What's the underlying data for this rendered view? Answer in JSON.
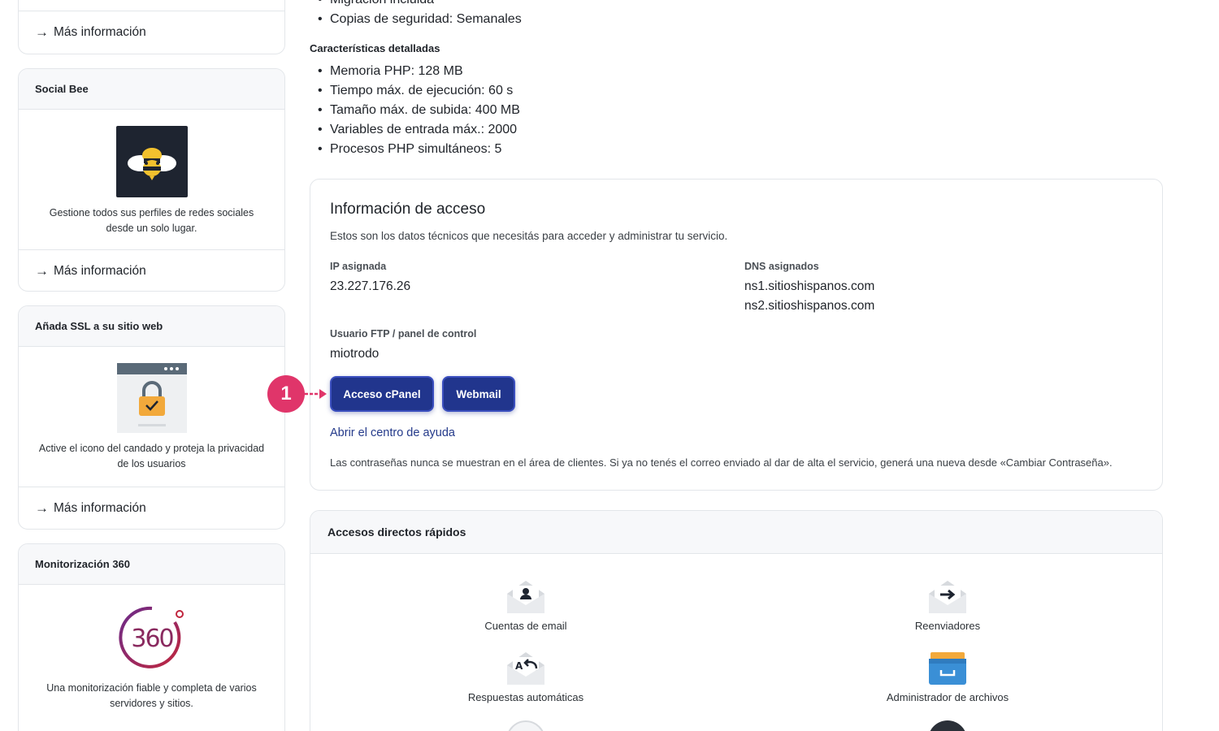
{
  "sidebar": {
    "more_info": "Más información",
    "cards": [
      {
        "title": "Social Bee",
        "description": "Gestione todos sus perfiles de redes sociales desde un solo lugar.",
        "link": "Más información"
      },
      {
        "title": "Añada SSL a su sitio web",
        "description": "Active el icono del candado y proteja la privacidad de los usuarios",
        "link": "Más información"
      },
      {
        "title": "Monitorización 360",
        "description": "Una monitorización fiable y completa de varios servidores y sitios.",
        "logo_text": "360"
      }
    ]
  },
  "plan": {
    "top_bullets": [
      "Migración incluida",
      "Copias de seguridad: Semanales"
    ],
    "detailed_heading": "Características detalladas",
    "detailed": [
      "Memoria PHP: 128 MB",
      "Tiempo máx. de ejecución: 60 s",
      "Tamaño máx. de subida: 400 MB",
      "Variables de entrada máx.: 2000",
      "Procesos PHP simultáneos: 5"
    ]
  },
  "access": {
    "title": "Información de acceso",
    "description": "Estos son los datos técnicos que necesitás para acceder y administrar tu servicio.",
    "ip_label": "IP asignada",
    "ip_value": "23.227.176.26",
    "dns_label": "DNS asignados",
    "dns_values": [
      "ns1.sitioshispanos.com",
      "ns2.sitioshispanos.com"
    ],
    "user_label": "Usuario FTP / panel de control",
    "user_value": "miotrodo",
    "cpanel_button": "Acceso cPanel",
    "webmail_button": "Webmail",
    "help_link": "Abrir el centro de ayuda",
    "note": "Las contraseñas nunca se muestran en el área de clientes. Si ya no tenés el correo enviado al dar de alta el servicio, generá una nueva desde «Cambiar Contraseña»."
  },
  "annotation": {
    "step": "1",
    "color": "#e0356a"
  },
  "quick": {
    "title": "Accesos directos rápidos",
    "items": [
      {
        "label": "Cuentas de email",
        "icon": "email-accounts-icon"
      },
      {
        "label": "Reenviadores",
        "icon": "forwarders-icon"
      },
      {
        "label": "Respuestas automáticas",
        "icon": "autoresponders-icon"
      },
      {
        "label": "Administrador de archivos",
        "icon": "file-manager-icon"
      }
    ]
  },
  "colors": {
    "primary_button": "#21358d",
    "link": "#243a8a",
    "border": "#e3e6ea"
  }
}
